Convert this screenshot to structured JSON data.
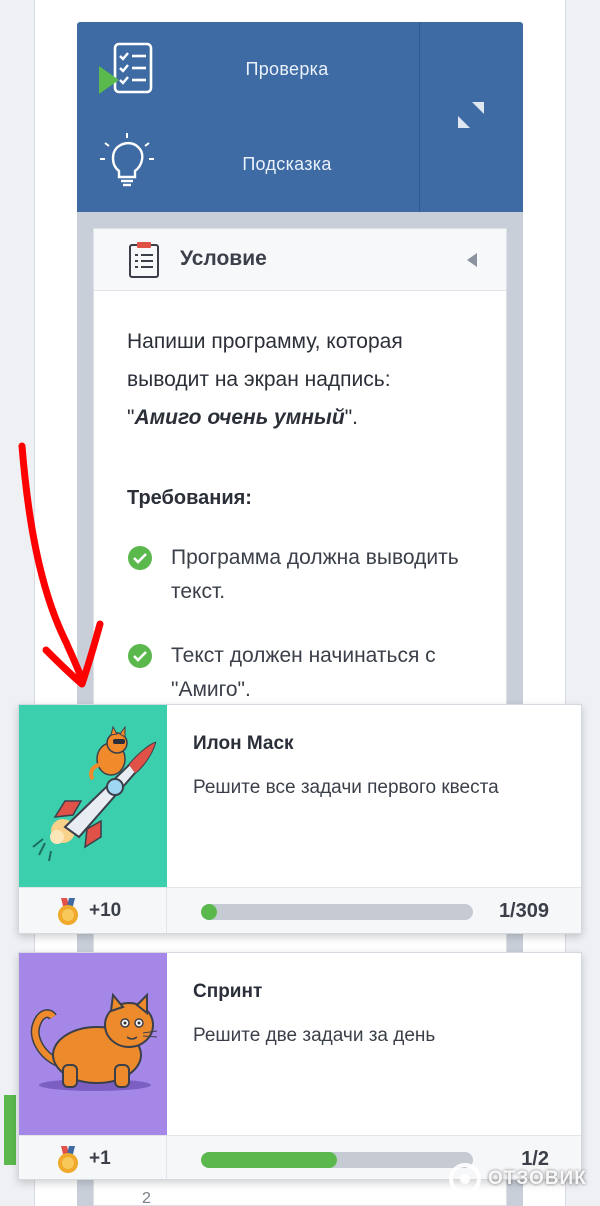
{
  "toolbar": {
    "check_label": "Проверка",
    "hint_label": "Подсказка"
  },
  "condition": {
    "title": "Условие",
    "task_text_1": "Напиши программу, которая выводит на экран надпись:",
    "task_quote_open": "\"",
    "task_highlight": "Амиго очень умный",
    "task_quote_close": "\".",
    "requirements_title": "Требования:",
    "requirements": [
      {
        "text": "Программа должна выводить текст."
      },
      {
        "text": "Текст должен начинаться с \"Амиго\"."
      }
    ]
  },
  "achievements": [
    {
      "title": "Илон Маск",
      "description": "Решите все задачи первого квеста",
      "points": "+10",
      "progress_text": "1/309",
      "progress_fraction": 0.0032,
      "image": "cat-on-rocket"
    },
    {
      "title": "Спринт",
      "description": "Решите две задачи за день",
      "points": "+1",
      "progress_text": "1/2",
      "progress_fraction": 0.5,
      "image": "walking-cat"
    }
  ],
  "underlying": {
    "line_number": "2"
  },
  "watermark": {
    "text": "ОТЗОВИК"
  },
  "colors": {
    "toolbar_bg": "#3e6ba3",
    "accent_green": "#5ab84c",
    "annotation_red": "#ff0000"
  }
}
